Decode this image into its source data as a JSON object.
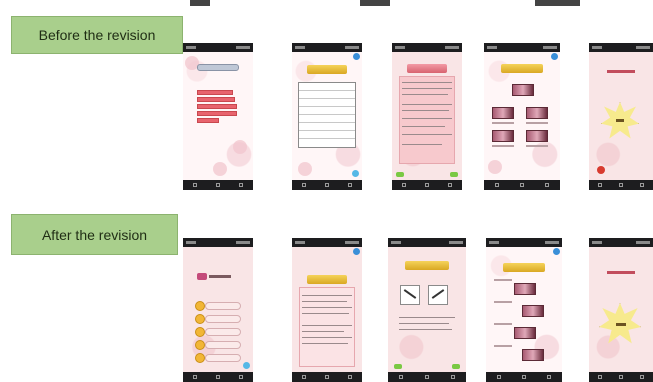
{
  "labels": {
    "before": "Before the revision",
    "after": "After the revision"
  },
  "colors": {
    "label_fill": "#a9cf8c",
    "phone_frame": "#1d1d1f",
    "screen_pink": "#f9e5e6",
    "menu_red": "#e8646e",
    "banner_gold": "#f5d35a",
    "button_orange": "#f2b636"
  },
  "screens": {
    "before": [
      "menu",
      "kompetensi-table",
      "materi-text",
      "video-list",
      "nilai-akhir"
    ],
    "after": [
      "menu",
      "kompetensi-text",
      "latihan-ab",
      "video-list",
      "nilai-akhir"
    ]
  },
  "icons": [
    "info-icon",
    "back-arrow-icon",
    "next-arrow-icon",
    "home-icon",
    "android-nav-icons"
  ]
}
